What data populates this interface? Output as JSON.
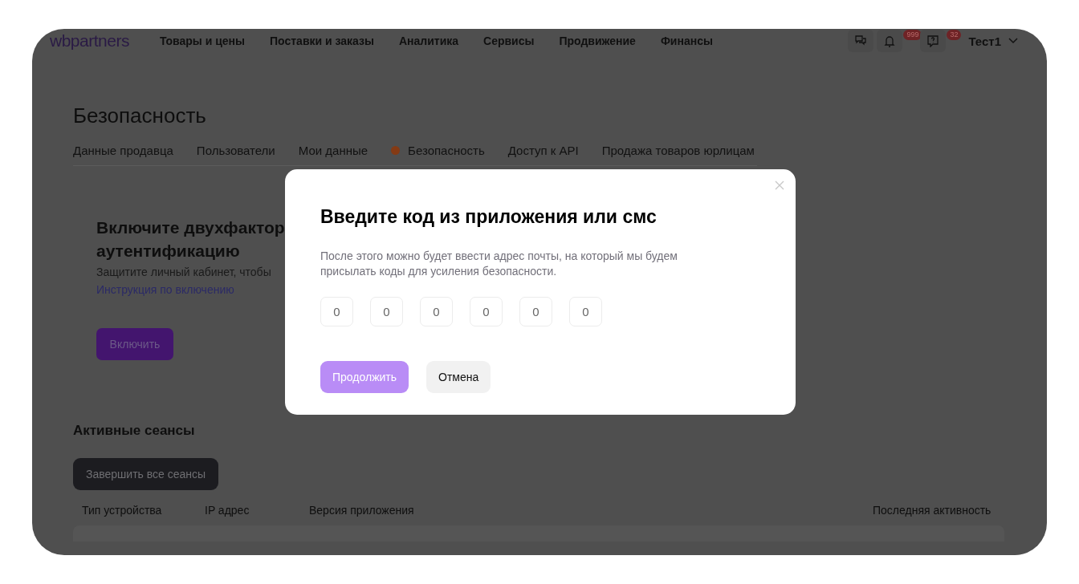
{
  "header": {
    "logo": "wbpartners",
    "nav": [
      {
        "label": "Товары и цены"
      },
      {
        "label": "Поставки и заказы"
      },
      {
        "label": "Аналитика"
      },
      {
        "label": "Сервисы"
      },
      {
        "label": "Продвижение"
      },
      {
        "label": "Финансы"
      }
    ],
    "icons": [
      {
        "kind": "chat"
      },
      {
        "kind": "bell",
        "badge": "999"
      },
      {
        "kind": "help",
        "badge": "32"
      }
    ],
    "user": "Тест1"
  },
  "page": {
    "title": "Безопасность",
    "tabs": [
      {
        "label": "Данные продавца",
        "selected": false
      },
      {
        "label": "Пользователи",
        "selected": false
      },
      {
        "label": "Мои данные",
        "selected": false
      },
      {
        "label": "Безопасность",
        "selected": true
      },
      {
        "label": "Доступ к API",
        "selected": false
      },
      {
        "label": "Продажа товаров юрлицам",
        "selected": false
      }
    ],
    "twofa": {
      "heading": "Включите двухфактор аутентификацию",
      "text": "Защитите личный кабинет, чтобы",
      "link": "Инструкция по включению",
      "button": "Включить"
    },
    "sessions": {
      "title": "Активные сеансы",
      "button": "Завершить все сеансы",
      "columns": [
        "Тип устройства",
        "IP адрес",
        "Версия приложения",
        "Последняя активность"
      ]
    }
  },
  "modal": {
    "title": "Введите код из приложения или смс",
    "text": "После этого можно будет ввести адрес почты, на который мы будем присылать коды для усиления безопасности.",
    "code": [
      {
        "placeholder": "0"
      },
      {
        "placeholder": "0"
      },
      {
        "placeholder": "0"
      },
      {
        "placeholder": "0"
      },
      {
        "placeholder": "0"
      },
      {
        "placeholder": "0"
      }
    ],
    "buttons": [
      {
        "label": "Продолжить",
        "disabled": true
      },
      {
        "label": "Отмена",
        "disabled": false
      }
    ]
  }
}
